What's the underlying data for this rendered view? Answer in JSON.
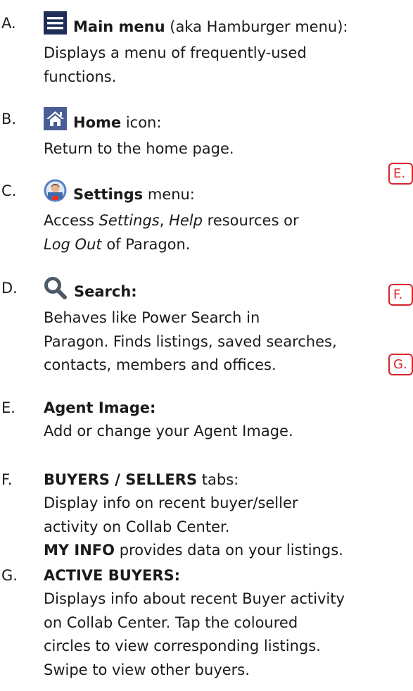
{
  "items": [
    {
      "letter": "A.",
      "icon": "hamburger-icon",
      "title": "Main menu",
      "title_suffix": "(aka Hamburger menu):",
      "desc_lines": [
        "Displays a menu of frequently-used",
        "functions."
      ]
    },
    {
      "letter": "B.",
      "icon": "home-icon",
      "title": "Home",
      "title_suffix": "icon:",
      "desc_lines": [
        "Return to the home page."
      ]
    },
    {
      "letter": "C.",
      "icon": "settings-avatar-icon",
      "title": "Settings",
      "title_suffix": "menu:",
      "desc_line1": {
        "pre": "Access ",
        "settings": "Settings",
        "comma": ", ",
        "help": "Help",
        "post": " resources or"
      },
      "desc_line2": {
        "logout": "Log Out",
        "post": " of Paragon."
      }
    },
    {
      "letter": "D.",
      "icon": "search-icon",
      "title": "Search:",
      "desc_lines": [
        "Behaves like Power Search in",
        "Paragon. Finds listings, saved searches,",
        "contacts, members and offices."
      ]
    },
    {
      "letter": "E.",
      "title": "Agent Image:",
      "desc_lines": [
        "Add or change your Agent Image."
      ]
    },
    {
      "letter": "F.",
      "title": "BUYERS / SELLERS",
      "title_suffix": "tabs:",
      "desc_lines": [
        "Display info on recent buyer/seller",
        "activity on Collab Center."
      ],
      "extra_bold": "MY INFO",
      "extra_rest": " provides data on your listings."
    },
    {
      "letter": "G.",
      "title": "ACTIVE BUYERS:",
      "desc_lines": [
        "Displays info about recent Buyer activity",
        "on Collab Center. Tap the coloured",
        "circles to view corresponding listings.",
        "Swipe to view other buyers."
      ]
    }
  ],
  "callouts": [
    "E.",
    "F.",
    "G."
  ],
  "colors": {
    "callout_red": "#d9232d",
    "menu_navy": "#1f2d57",
    "home_blue": "#4a5e95",
    "search_gray": "#4c5966"
  }
}
